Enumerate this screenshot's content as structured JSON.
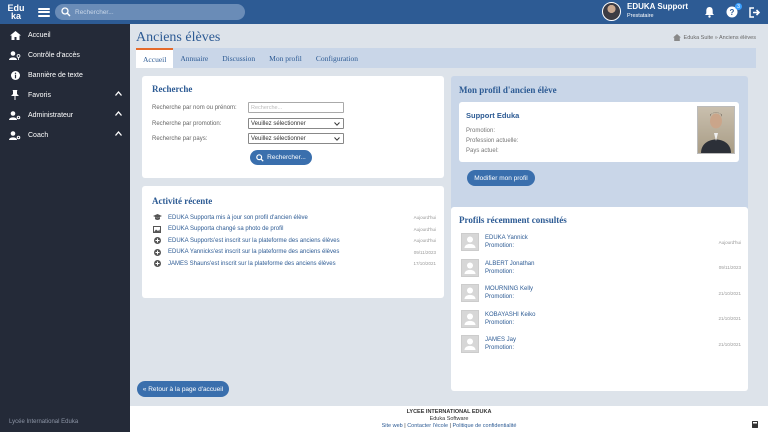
{
  "header": {
    "logo_top": "Edu",
    "logo_bottom": "ka",
    "search_placeholder": "Rechercher...",
    "user_name": "EDUKA Support",
    "user_role": "Prestataire",
    "help_badge": "3"
  },
  "sidebar": {
    "items": [
      {
        "label": "Accueil",
        "icon": "home-icon"
      },
      {
        "label": "Contrôle d'accès",
        "icon": "user-key-icon"
      },
      {
        "label": "Bannière de texte",
        "icon": "info-icon"
      },
      {
        "label": "Favoris",
        "icon": "pin-icon"
      },
      {
        "label": "Administrateur",
        "icon": "user-gear-icon"
      },
      {
        "label": "Coach",
        "icon": "user-gear-icon"
      }
    ],
    "footer": "Lycée International Eduka"
  },
  "page": {
    "title": "Anciens élèves",
    "breadcrumb": "Eduka Suite » Anciens élèves",
    "tabs": [
      "Accueil",
      "Annuaire",
      "Discussion",
      "Mon profil",
      "Configuration"
    ],
    "active_tab": 0
  },
  "search": {
    "title": "Recherche",
    "name_label": "Recherche par nom ou prénom:",
    "name_placeholder": "Recherche...",
    "promo_label": "Recherche par promotion:",
    "promo_value": "Veuillez sélectionner",
    "country_label": "Recherche par pays:",
    "country_value": "Veuillez sélectionner",
    "button": "Rechercher..."
  },
  "activity": {
    "title": "Activité récente",
    "items": [
      {
        "icon": "graduation-cap-icon",
        "user": "EDUKA Support",
        "text": " a mis à jour son profil d'ancien élève",
        "date": "Aujourd'hui"
      },
      {
        "icon": "image-icon",
        "user": "EDUKA Support",
        "text": " a changé sa photo de profil",
        "date": "Aujourd'hui"
      },
      {
        "icon": "plus-circle-icon",
        "user": "EDUKA Support",
        "text": " s'est inscrit sur la plateforme des anciens élèves",
        "date": "Aujourd'hui"
      },
      {
        "icon": "plus-circle-icon",
        "user": "EDUKA Yannick",
        "text": " s'est inscrit sur la plateforme des anciens élèves",
        "date": "09/11/2023"
      },
      {
        "icon": "plus-circle-icon",
        "user": "JAMES Shaun",
        "text": " s'est inscrit sur la plateforme des anciens élèves",
        "date": "17/10/2021"
      }
    ]
  },
  "my_profile": {
    "title": "Mon profil d'ancien élève",
    "name": "Support Eduka",
    "promotion_label": "Promotion:",
    "profession_label": "Profession actuelle:",
    "country_label": "Pays actuel:",
    "button": "Modifier mon profil"
  },
  "recent_profiles": {
    "title": "Profils récemment consultés",
    "promotion_label": "Promotion:",
    "items": [
      {
        "name": "EDUKA Yannick",
        "date": "Aujourd'hui"
      },
      {
        "name": "ALBERT Jonathan",
        "date": "09/11/2023"
      },
      {
        "name": "MOURNING Kelly",
        "date": "21/10/2021"
      },
      {
        "name": "KOBAYASHI Keiko",
        "date": "21/10/2021"
      },
      {
        "name": "JAMES Jay",
        "date": "21/10/2021"
      }
    ]
  },
  "back_button": "« Retour à la page d'accueil",
  "footer": {
    "school": "LYCEE INTERNATIONAL EDUKA",
    "company": "Eduka Software",
    "link1": "Site web",
    "sep1": " | ",
    "link2": "Contacter l'école",
    "sep2": " | ",
    "link3": "Politique de confidentialité"
  }
}
